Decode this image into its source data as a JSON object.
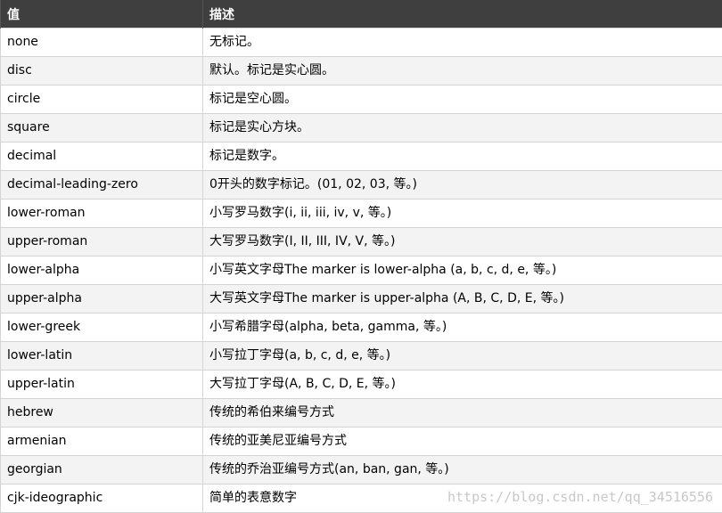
{
  "table": {
    "headers": [
      "值",
      "描述"
    ],
    "rows": [
      {
        "value": "none",
        "desc": "无标记。"
      },
      {
        "value": "disc",
        "desc": "默认。标记是实心圆。"
      },
      {
        "value": "circle",
        "desc": "标记是空心圆。"
      },
      {
        "value": "square",
        "desc": "标记是实心方块。"
      },
      {
        "value": "decimal",
        "desc": "标记是数字。"
      },
      {
        "value": "decimal-leading-zero",
        "desc": "0开头的数字标记。(01, 02, 03, 等。)"
      },
      {
        "value": "lower-roman",
        "desc": "小写罗马数字(i, ii, iii, iv, v, 等。)"
      },
      {
        "value": "upper-roman",
        "desc": "大写罗马数字(I, II, III, IV, V, 等。)"
      },
      {
        "value": "lower-alpha",
        "desc": "小写英文字母The marker is lower-alpha (a, b, c, d, e, 等。)"
      },
      {
        "value": "upper-alpha",
        "desc": "大写英文字母The marker is upper-alpha (A, B, C, D, E, 等。)"
      },
      {
        "value": "lower-greek",
        "desc": "小写希腊字母(alpha, beta, gamma, 等。)"
      },
      {
        "value": "lower-latin",
        "desc": "小写拉丁字母(a, b, c, d, e, 等。)"
      },
      {
        "value": "upper-latin",
        "desc": "大写拉丁字母(A, B, C, D, E, 等。)"
      },
      {
        "value": "hebrew",
        "desc": "传统的希伯来编号方式"
      },
      {
        "value": "armenian",
        "desc": "传统的亚美尼亚编号方式"
      },
      {
        "value": "georgian",
        "desc": "传统的乔治亚编号方式(an, ban, gan, 等。)"
      },
      {
        "value": "cjk-ideographic",
        "desc": "简单的表意数字"
      }
    ]
  },
  "watermark": "https://blog.csdn.net/qq_34516556"
}
